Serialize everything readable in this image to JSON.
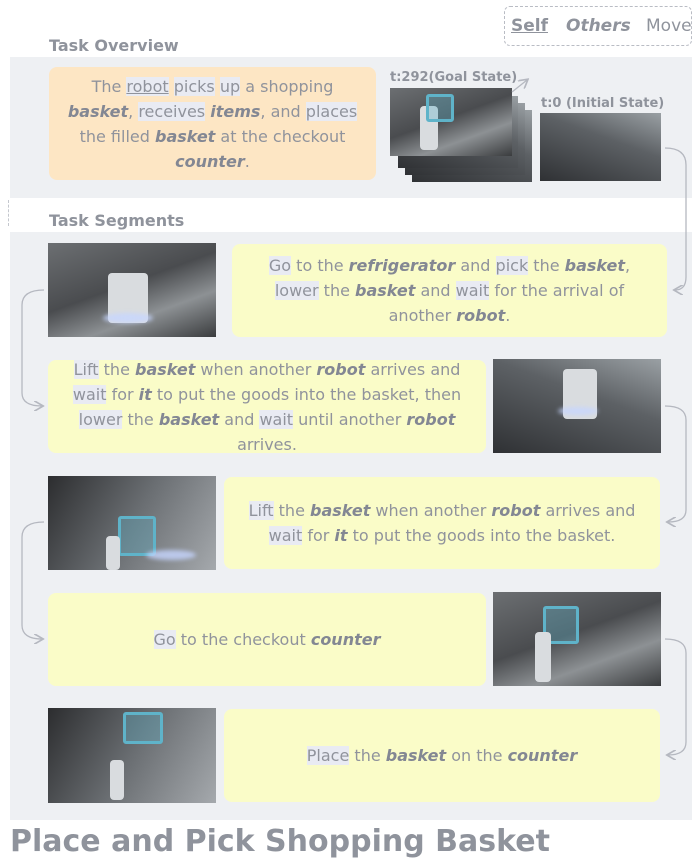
{
  "mode_switch": {
    "self_label": "Self",
    "others_label": "Others",
    "move_label": "Move"
  },
  "overview": {
    "header": "Task Overview",
    "goal_label": "t:292(Goal State)",
    "initial_label": "t:0 (Initial State)",
    "description": [
      {
        "t": "The "
      },
      {
        "t": "robot",
        "s": "hu"
      },
      {
        "t": " "
      },
      {
        "t": "picks",
        "s": "h"
      },
      {
        "t": " "
      },
      {
        "t": "up",
        "s": "h"
      },
      {
        "t": " a shopping "
      },
      {
        "t": "basket",
        "s": "b"
      },
      {
        "t": ", "
      },
      {
        "t": "receives",
        "s": "h"
      },
      {
        "t": " "
      },
      {
        "t": "items",
        "s": "b"
      },
      {
        "t": ", and "
      },
      {
        "t": "places",
        "s": "h"
      },
      {
        "t": " the filled "
      },
      {
        "t": "basket",
        "s": "b"
      },
      {
        "t": " at the checkout "
      },
      {
        "t": "counter",
        "s": "b"
      },
      {
        "t": "."
      }
    ]
  },
  "segments_header": "Task Segments",
  "segments": [
    {
      "text": [
        {
          "t": "Go",
          "s": "h"
        },
        {
          "t": " to the "
        },
        {
          "t": "refrigerator",
          "s": "b"
        },
        {
          "t": " and "
        },
        {
          "t": "pick",
          "s": "h"
        },
        {
          "t": " the "
        },
        {
          "t": "basket",
          "s": "b"
        },
        {
          "t": ",  "
        },
        {
          "t": "lower",
          "s": "h"
        },
        {
          "t": " the "
        },
        {
          "t": "basket",
          "s": "b"
        },
        {
          "t": " and "
        },
        {
          "t": "wait",
          "s": "h"
        },
        {
          "t": " for the arrival of another "
        },
        {
          "t": "robot",
          "s": "b"
        },
        {
          "t": "."
        }
      ]
    },
    {
      "text": [
        {
          "t": "Lift",
          "s": "h"
        },
        {
          "t": " the "
        },
        {
          "t": "basket",
          "s": "b"
        },
        {
          "t": " when another "
        },
        {
          "t": "robot",
          "s": "b"
        },
        {
          "t": " arrives and "
        },
        {
          "t": "wait",
          "s": "h"
        },
        {
          "t": " for "
        },
        {
          "t": "it",
          "s": "b"
        },
        {
          "t": " to put the goods into the basket, then "
        },
        {
          "t": "lower",
          "s": "h"
        },
        {
          "t": " the "
        },
        {
          "t": "basket",
          "s": "b"
        },
        {
          "t": " and "
        },
        {
          "t": "wait",
          "s": "h"
        },
        {
          "t": " until another "
        },
        {
          "t": "robot",
          "s": "b"
        },
        {
          "t": " arrives."
        }
      ]
    },
    {
      "text": [
        {
          "t": "Lift",
          "s": "h"
        },
        {
          "t": " the "
        },
        {
          "t": "basket",
          "s": "b"
        },
        {
          "t": " when another "
        },
        {
          "t": "robot",
          "s": "b"
        },
        {
          "t": " arrives and "
        },
        {
          "t": "wait",
          "s": "h"
        },
        {
          "t": " for "
        },
        {
          "t": "it",
          "s": "b"
        },
        {
          "t": " to put the goods into the basket."
        }
      ]
    },
    {
      "text": [
        {
          "t": "Go",
          "s": "h"
        },
        {
          "t": " to the checkout "
        },
        {
          "t": "counter",
          "s": "b"
        }
      ]
    },
    {
      "text": [
        {
          "t": "Place",
          "s": "h"
        },
        {
          "t": " the "
        },
        {
          "t": "basket",
          "s": "b"
        },
        {
          "t": " on the "
        },
        {
          "t": "counter",
          "s": "b"
        }
      ]
    }
  ],
  "title": "Place and Pick Shopping Basket",
  "colors": {
    "segment_box": "#fafcc8",
    "overview_box": "#fde6c4",
    "panel": "#eef0f3",
    "text": "#8f939c",
    "word_highlight": "#e9ebf3"
  }
}
